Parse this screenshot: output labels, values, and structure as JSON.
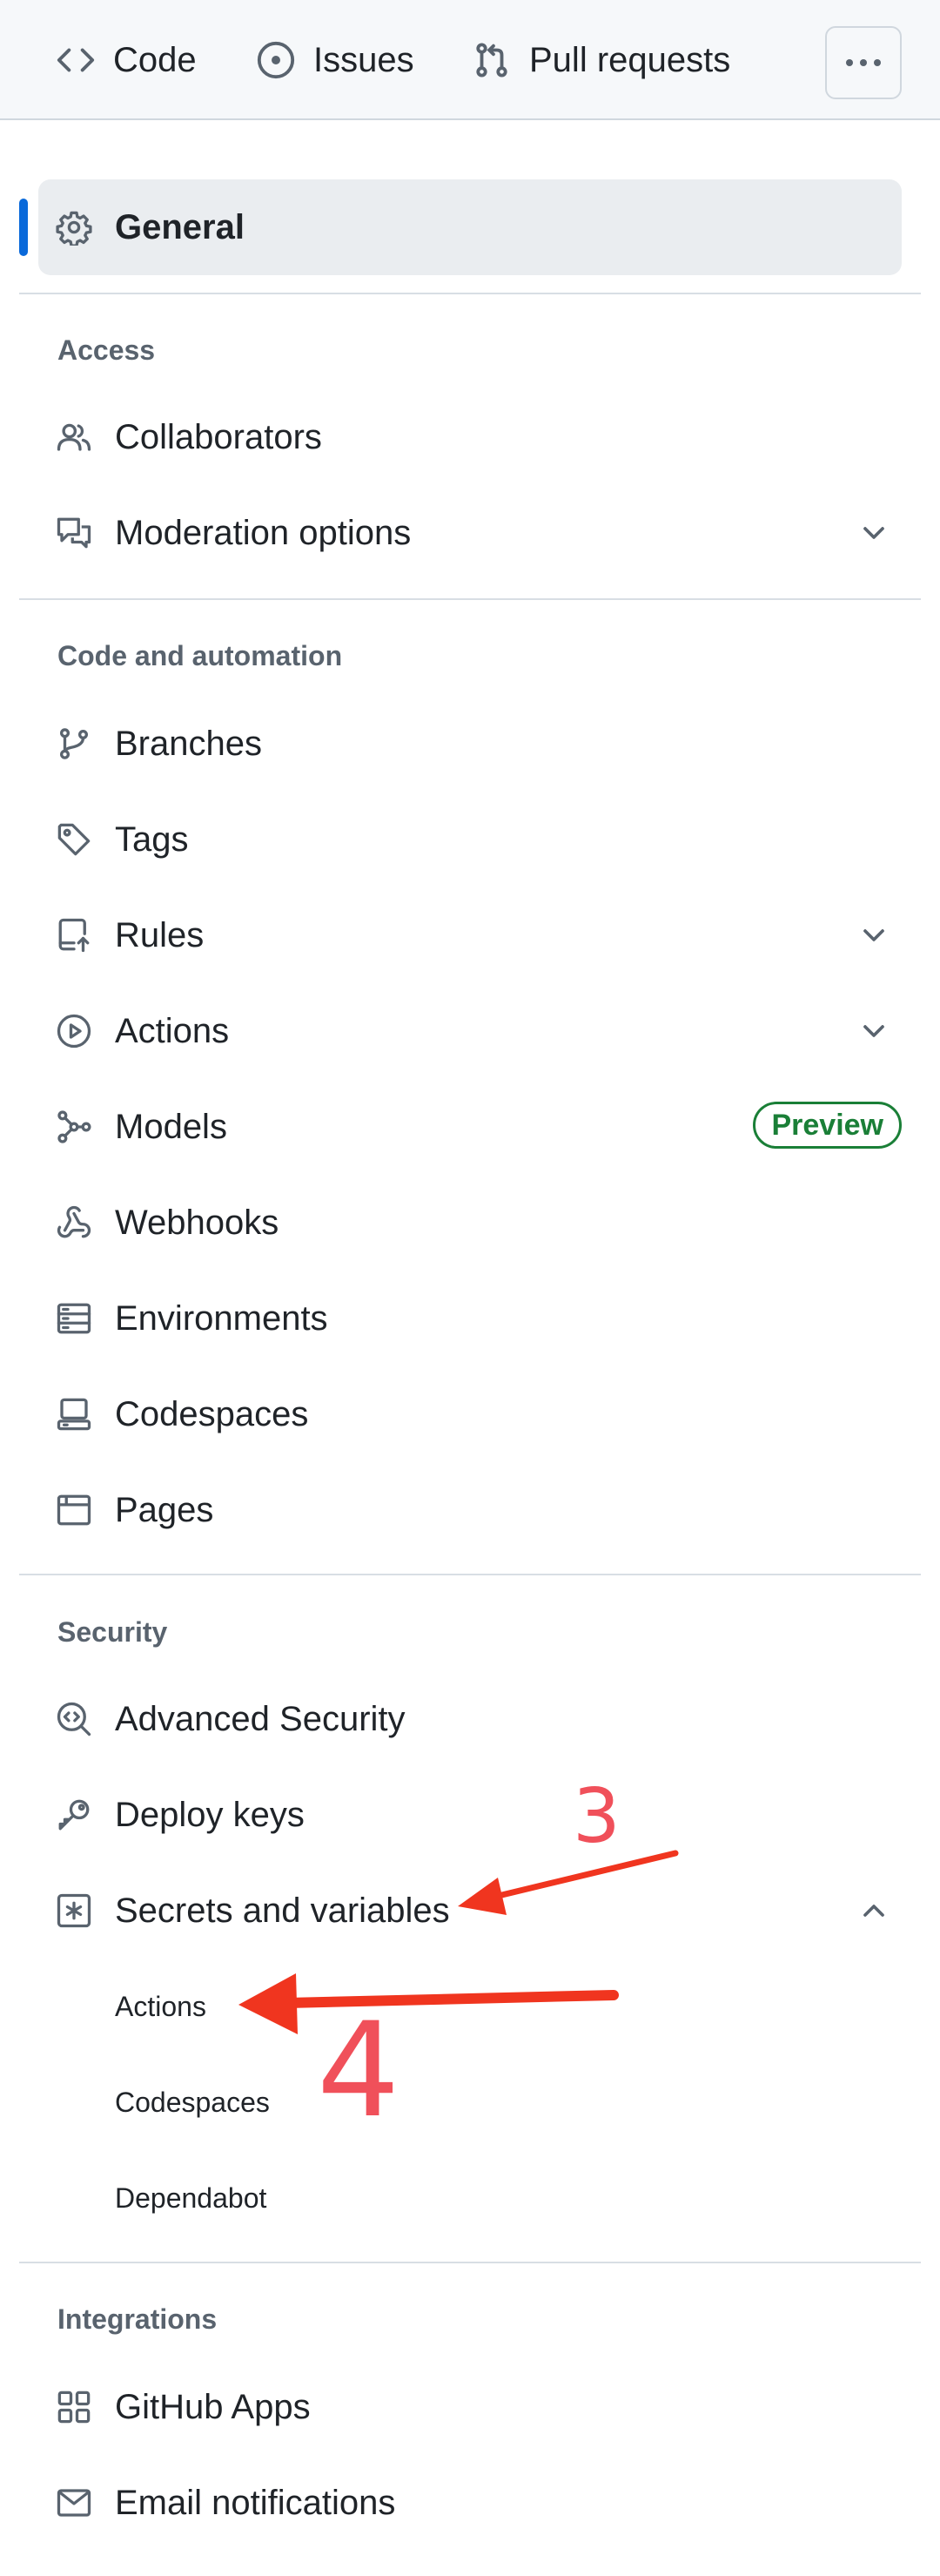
{
  "topnav": {
    "tabs": [
      {
        "label": "Code",
        "icon": "code-icon"
      },
      {
        "label": "Issues",
        "icon": "issue-opened-icon"
      },
      {
        "label": "Pull requests",
        "icon": "git-pull-request-icon"
      }
    ],
    "more_icon": "kebab-horizontal-icon"
  },
  "sidebar": {
    "general": {
      "label": "General",
      "icon": "gear-icon",
      "selected": true
    },
    "sections": [
      {
        "heading": "Access",
        "items": [
          {
            "label": "Collaborators",
            "icon": "people-icon"
          },
          {
            "label": "Moderation options",
            "icon": "comment-discussion-icon",
            "expandable": true
          }
        ]
      },
      {
        "heading": "Code and automation",
        "items": [
          {
            "label": "Branches",
            "icon": "git-branch-icon"
          },
          {
            "label": "Tags",
            "icon": "tag-icon"
          },
          {
            "label": "Rules",
            "icon": "repo-push-icon",
            "expandable": true
          },
          {
            "label": "Actions",
            "icon": "play-icon",
            "expandable": true
          },
          {
            "label": "Models",
            "icon": "models-icon",
            "badge": "Preview"
          },
          {
            "label": "Webhooks",
            "icon": "webhook-icon"
          },
          {
            "label": "Environments",
            "icon": "server-icon"
          },
          {
            "label": "Codespaces",
            "icon": "codespaces-icon"
          },
          {
            "label": "Pages",
            "icon": "browser-icon"
          }
        ]
      },
      {
        "heading": "Security",
        "items": [
          {
            "label": "Advanced Security",
            "icon": "codescan-icon"
          },
          {
            "label": "Deploy keys",
            "icon": "key-icon"
          },
          {
            "label": "Secrets and variables",
            "icon": "key-asterisk-icon",
            "expanded": true,
            "subitems": [
              "Actions",
              "Codespaces",
              "Dependabot"
            ]
          }
        ]
      },
      {
        "heading": "Integrations",
        "items": [
          {
            "label": "GitHub Apps",
            "icon": "apps-icon"
          },
          {
            "label": "Email notifications",
            "icon": "mail-icon"
          }
        ]
      }
    ]
  },
  "annotations": {
    "step3": "3",
    "step4": "4",
    "arrow_color": "#f0351f",
    "number_color": "#f0505a"
  },
  "colors": {
    "accent": "#0969da",
    "badge_green": "#1a7f37",
    "text_muted": "#59636e"
  }
}
